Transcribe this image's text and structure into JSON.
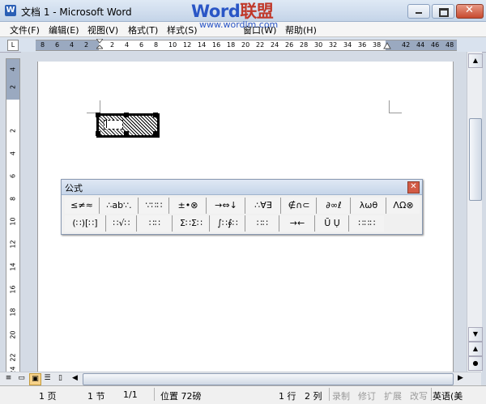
{
  "window": {
    "icon_glyph": "W",
    "title": "文档 1 - Microsoft Word",
    "min_icon": "minimize-icon",
    "max_icon": "maximize-icon",
    "close_glyph": "✕"
  },
  "watermark": {
    "brand_word": "Word",
    "brand_cn": "联盟",
    "url": "www.wordlm.com"
  },
  "menu": [
    "文件(F)",
    "编辑(E)",
    "视图(V)",
    "格式(T)",
    "样式(S)",
    "窗口(W)",
    "帮助(H)"
  ],
  "ruler": {
    "corner_glyph": "L",
    "h_numbers": [
      "8",
      "6",
      "4",
      "2",
      "2",
      "4",
      "6",
      "8",
      "10",
      "12",
      "14",
      "16",
      "18",
      "20",
      "22",
      "24",
      "26",
      "28",
      "30",
      "32",
      "34",
      "36",
      "38",
      "42",
      "44",
      "46",
      "48"
    ],
    "v_numbers": [
      "4",
      "2",
      "2",
      "4",
      "6",
      "8",
      "10",
      "12",
      "14",
      "16",
      "18",
      "20",
      "22",
      "24"
    ]
  },
  "equation_toolbar": {
    "title": "公式",
    "close_glyph": "✕",
    "row1": [
      "≤≠≈",
      "∴ab∵.",
      "∵∷∷",
      "±•⊗",
      "→⇔↓",
      "∴∀∃",
      "∉∩⊂",
      "∂∞ℓ",
      "λωθ",
      "ΛΩ⊗"
    ],
    "row2": [
      "(∷)[∷]",
      "∷√∷",
      "∷∷",
      "Σ∷Σ∷",
      "∫∷∮∷",
      "∷∷",
      "→←",
      "Ū Ụ",
      "∷∷∷"
    ]
  },
  "status": {
    "page": "1 页",
    "section": "1 节",
    "pages": "1/1",
    "position": "位置 72磅",
    "line": "1 行",
    "col": "2 列",
    "rec": "录制",
    "trk": "修订",
    "ext": "扩展",
    "ovr": "改写",
    "lang": "英语(美"
  },
  "colors": {
    "watermark_red": "#c0392b",
    "watermark_blue": "#2a56c6",
    "title_bg": "#c4d4e8",
    "close_red": "#c74a2f"
  }
}
